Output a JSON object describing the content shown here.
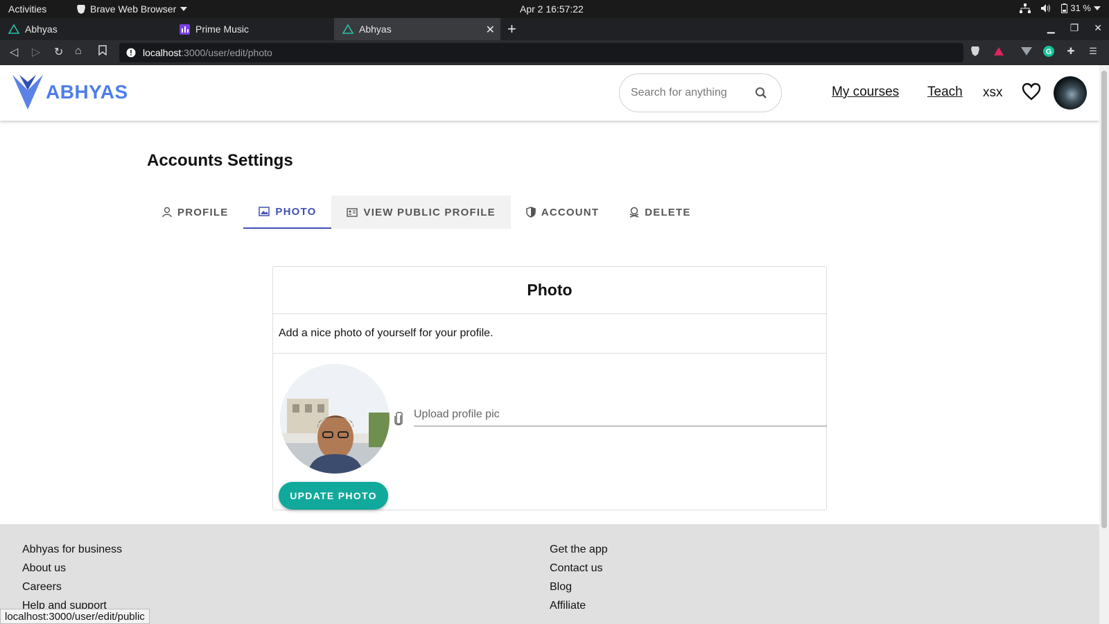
{
  "system": {
    "activities": "Activities",
    "app_menu": "Brave Web Browser",
    "clock": "Apr 2  16:57:22",
    "battery": "31 %"
  },
  "browser": {
    "tabs": [
      {
        "label": "Abhyas"
      },
      {
        "label": "Prime Music"
      },
      {
        "label": "Abhyas"
      }
    ],
    "url_host": "localhost",
    "url_path": ":3000/user/edit/photo",
    "status_url": "localhost:3000/user/edit/public"
  },
  "header": {
    "logo_text": "ABHYAS",
    "search_placeholder": "Search for anything",
    "links": {
      "my_courses": "My courses",
      "teach": "Teach",
      "user": "xsx"
    }
  },
  "page": {
    "title": "Accounts Settings",
    "tabs": [
      {
        "label": "Profile",
        "icon": "person-icon"
      },
      {
        "label": "Photo",
        "icon": "image-icon"
      },
      {
        "label": "View public profile",
        "icon": "id-card-icon"
      },
      {
        "label": "Account",
        "icon": "shield-icon"
      },
      {
        "label": "Delete",
        "icon": "skull-icon"
      }
    ]
  },
  "card": {
    "title": "Photo",
    "description": "Add a nice photo of yourself for your profile.",
    "upload_placeholder": "Upload profile pic",
    "update_button": "UPDATE PHOTO"
  },
  "footer": {
    "left": [
      "Abhyas for business",
      "About us",
      "Careers",
      "Help and support"
    ],
    "right": [
      "Get the app",
      "Contact us",
      "Blog",
      "Affiliate"
    ]
  },
  "colors": {
    "accent": "#3f51b5",
    "brand": "#4d7ee8",
    "button": "#11a99b"
  }
}
